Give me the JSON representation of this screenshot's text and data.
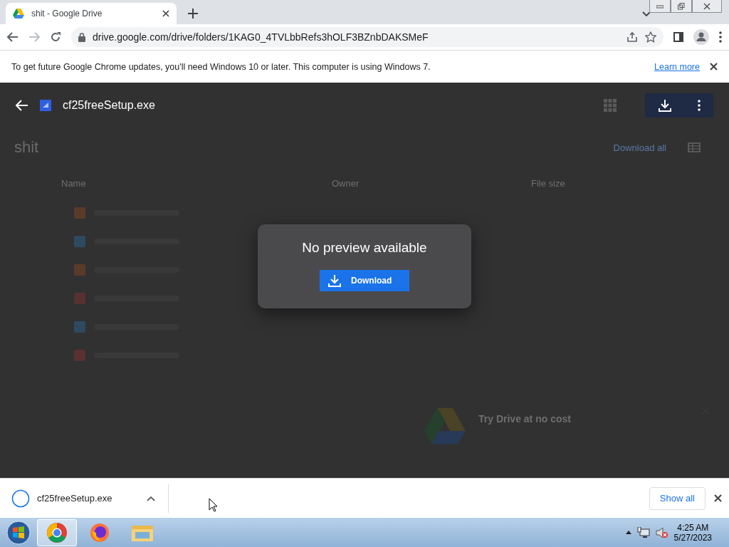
{
  "browser": {
    "tab": {
      "title": "shit - Google Drive"
    },
    "url": "drive.google.com/drive/folders/1KAG0_4TVLbbRefs3hOLF3BZnbDAKSMeF"
  },
  "infobar": {
    "message": "To get future Google Chrome updates, you'll need Windows 10 or later. This computer is using Windows 7.",
    "link": "Learn more"
  },
  "viewer": {
    "file_name": "cf25freeSetup.exe",
    "dialog": {
      "title": "No preview available",
      "button": "Download"
    }
  },
  "folder": {
    "title": "shit",
    "download_all": "Download all",
    "columns": [
      "Name",
      "Owner",
      "File size"
    ],
    "rows": [
      {
        "color": "#5a3a2c"
      },
      {
        "color": "#2e4a60"
      },
      {
        "color": "#5a3a2c"
      },
      {
        "color": "#583030"
      },
      {
        "color": "#2e4a60"
      },
      {
        "color": "#5a3030"
      }
    ]
  },
  "promo": {
    "title": "Try Drive at no cost"
  },
  "download_shelf": {
    "items": [
      {
        "name": "cf25freeSetup.exe"
      }
    ],
    "show_all": "Show all"
  },
  "taskbar": {
    "apps": [
      {
        "kind": "chrome",
        "selected": true
      },
      {
        "kind": "firefox",
        "selected": false
      },
      {
        "kind": "explorer",
        "selected": false
      }
    ],
    "time": "4:25 AM",
    "date": "5/27/2023"
  }
}
